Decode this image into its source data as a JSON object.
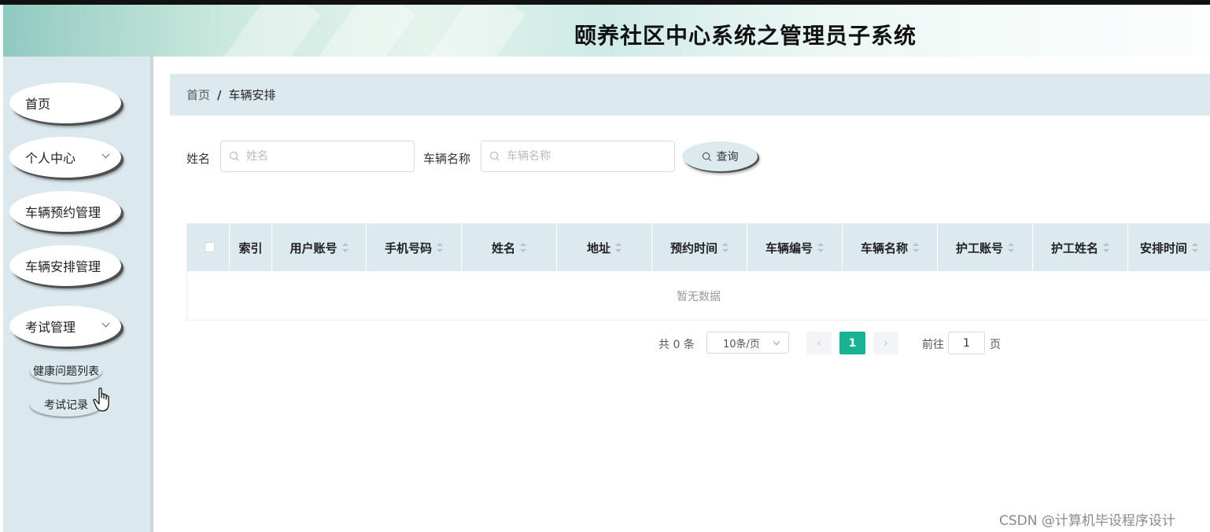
{
  "header": {
    "title": "颐养社区中心系统之管理员子系统"
  },
  "sidebar": {
    "items": [
      {
        "label": "首页",
        "has_chevron": false
      },
      {
        "label": "个人中心",
        "has_chevron": true
      },
      {
        "label": "车辆预约管理",
        "has_chevron": false
      },
      {
        "label": "车辆安排管理",
        "has_chevron": false
      },
      {
        "label": "考试管理",
        "has_chevron": true
      }
    ],
    "subitems": [
      {
        "label": "健康问题列表"
      },
      {
        "label": "考试记录"
      }
    ]
  },
  "breadcrumb": {
    "home": "首页",
    "separator": "/",
    "current": "车辆安排"
  },
  "search": {
    "name_label": "姓名",
    "name_placeholder": "姓名",
    "vehicle_label": "车辆名称",
    "vehicle_placeholder": "车辆名称",
    "query_button": "查询"
  },
  "table": {
    "columns": [
      "索引",
      "用户账号",
      "手机号码",
      "姓名",
      "地址",
      "预约时间",
      "车辆编号",
      "车辆名称",
      "护工账号",
      "护工姓名",
      "安排时间"
    ],
    "rows": [],
    "empty_text": "暂无数据"
  },
  "pagination": {
    "total_text": "共 0 条",
    "page_size": "10条/页",
    "prev": "‹",
    "current_page": "1",
    "next": "›",
    "goto_label": "前往",
    "goto_value": "1",
    "page_suffix": "页"
  },
  "watermark": "CSDN @计算机毕设程序设计",
  "colors": {
    "accent": "#19b394",
    "sidebar_bg": "#dbe9ee",
    "header_row_bg": "#dce9ee"
  }
}
